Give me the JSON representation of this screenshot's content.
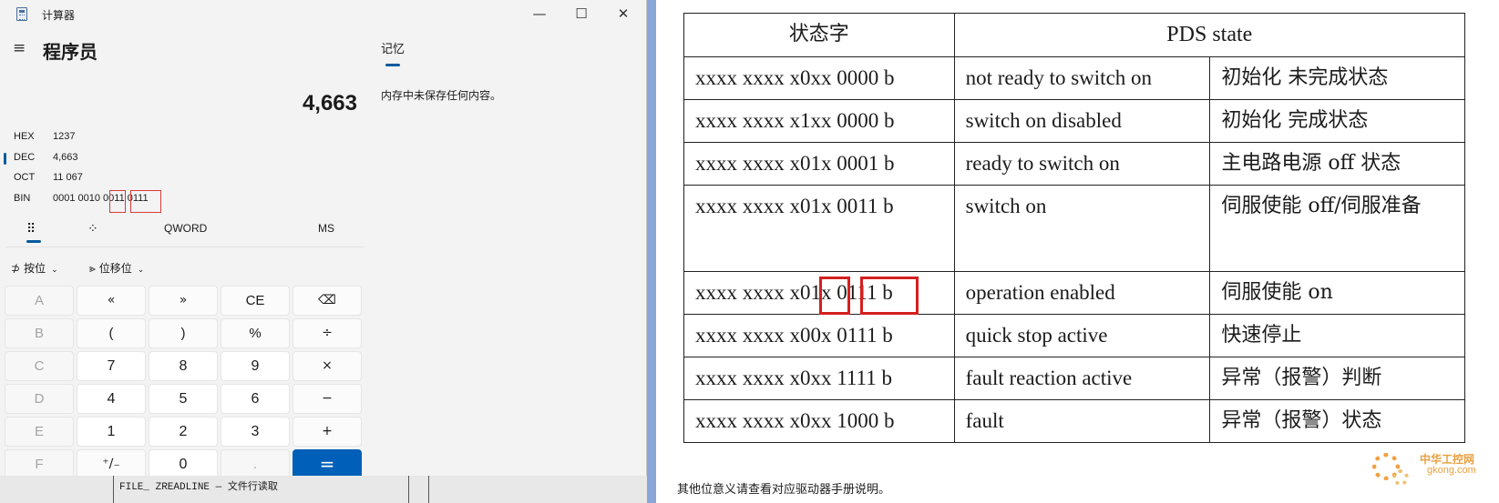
{
  "calculator": {
    "window_title": "计算器",
    "window_controls": {
      "minimize": "—",
      "maximize": "☐",
      "close": "✕"
    },
    "menu_icon": "hamburger-icon",
    "mode": "程序员",
    "display_value": "4,663",
    "radix": [
      {
        "key": "HEX",
        "value": "1237"
      },
      {
        "key": "DEC",
        "value": "4,663"
      },
      {
        "key": "OCT",
        "value": "11 067"
      },
      {
        "key": "BIN",
        "value": "0001 0010 0011 0111"
      }
    ],
    "active_radix": "DEC",
    "keypad_tabs": {
      "full_keypad_icon": "⠿",
      "bit_toggle_icon": "⁘",
      "word_size": "QWORD",
      "memory_store": "MS"
    },
    "bitwise": {
      "bitwise_icon": "⊅",
      "bitwise_label": "按位",
      "shift_icon": "⪢",
      "shift_label": "位移位",
      "chevron": "⌄"
    },
    "keys": [
      [
        "A",
        "«",
        "»",
        "CE",
        "⌫"
      ],
      [
        "B",
        "(",
        ")",
        "%",
        "÷"
      ],
      [
        "C",
        "7",
        "8",
        "9",
        "×"
      ],
      [
        "D",
        "4",
        "5",
        "6",
        "−"
      ],
      [
        "E",
        "1",
        "2",
        "3",
        "+"
      ],
      [
        "F",
        "⁺∕₋",
        "0",
        ".",
        "="
      ]
    ],
    "memory": {
      "title": "记忆",
      "empty_message": "内存中未保存任何内容。"
    },
    "background_text": "FILE_ ZREADLINE — 文件行读取"
  },
  "pds_table": {
    "headers": [
      "状态字",
      "PDS state"
    ],
    "rows": [
      {
        "word": "xxxx xxxx x0xx 0000 b",
        "state": "not ready to switch on",
        "desc": "初始化  未完成状态"
      },
      {
        "word": "xxxx xxxx x1xx 0000 b",
        "state": "switch on disabled",
        "desc": "初始化  完成状态"
      },
      {
        "word": "xxxx xxxx x01x 0001 b",
        "state": "ready to switch on",
        "desc": "主电路电源 off 状态"
      },
      {
        "word": "xxxx xxxx x01x 0011 b",
        "state": "switch on",
        "desc": "伺服使能 off/伺服准备"
      },
      {
        "word": "xxxx xxxx x01x 0111 b",
        "state": "operation enabled",
        "desc": "伺服使能 on"
      },
      {
        "word": "xxxx xxxx x00x 0111 b",
        "state": "quick stop active",
        "desc": "快速停止"
      },
      {
        "word": "xxxx xxxx x0xx 1111 b",
        "state": "fault reaction active",
        "desc": "异常（报警）判断"
      },
      {
        "word": "xxxx xxxx x0xx 1000 b",
        "state": "fault",
        "desc": "异常（报警）状态"
      }
    ],
    "note": "其他位意义请查看对应驱动器手册说明。"
  },
  "watermark": {
    "name": "中华工控网",
    "url": "gkong.com",
    "accent": "#e8a040"
  },
  "colors": {
    "accent": "#005fb8",
    "highlight": "#d4201f"
  }
}
